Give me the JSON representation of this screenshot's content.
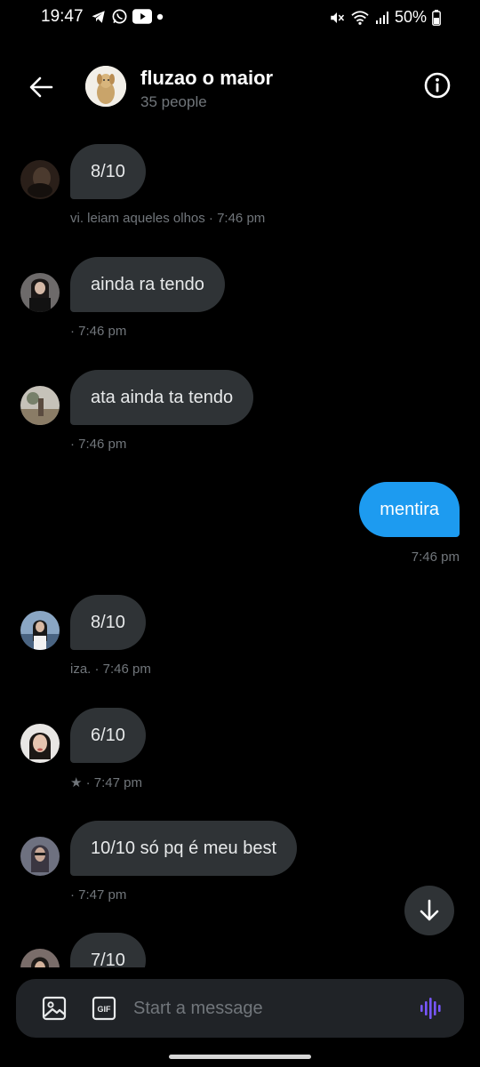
{
  "status_bar": {
    "time": "19:47",
    "battery": "50%",
    "left_icons": [
      "telegram-icon",
      "whatsapp-icon",
      "youtube-icon",
      "dot-icon"
    ],
    "right_icons": [
      "mute-icon",
      "wifi-icon",
      "signal-icon",
      "battery-icon"
    ]
  },
  "header": {
    "title": "fluzao o maior",
    "subtitle": "35 people"
  },
  "messages": [
    {
      "text": "8/10",
      "meta": "vi. leiam aqueles olhos · 7:46 pm",
      "own": false
    },
    {
      "text": "ainda ra tendo",
      "meta": "· 7:46 pm",
      "own": false
    },
    {
      "text": "ata ainda ta tendo",
      "meta": "· 7:46 pm",
      "own": false
    },
    {
      "text": "mentira",
      "meta": "7:46 pm",
      "own": true
    },
    {
      "text": "8/10",
      "meta": "iza. · 7:46 pm",
      "own": false
    },
    {
      "text": "6/10",
      "meta": "★ · 7:47 pm",
      "own": false
    },
    {
      "text": "10/10 só pq é meu best",
      "meta": "· 7:47 pm",
      "own": false
    },
    {
      "text": "7/10",
      "meta": "",
      "own": false
    }
  ],
  "composer": {
    "placeholder": "Start a message",
    "gif_label": "GIF",
    "accent_color": "#7856ff"
  },
  "colors": {
    "background": "#000000",
    "bubble_other": "#2f3336",
    "bubble_own": "#1d9bf0",
    "muted_text": "#71767b"
  }
}
